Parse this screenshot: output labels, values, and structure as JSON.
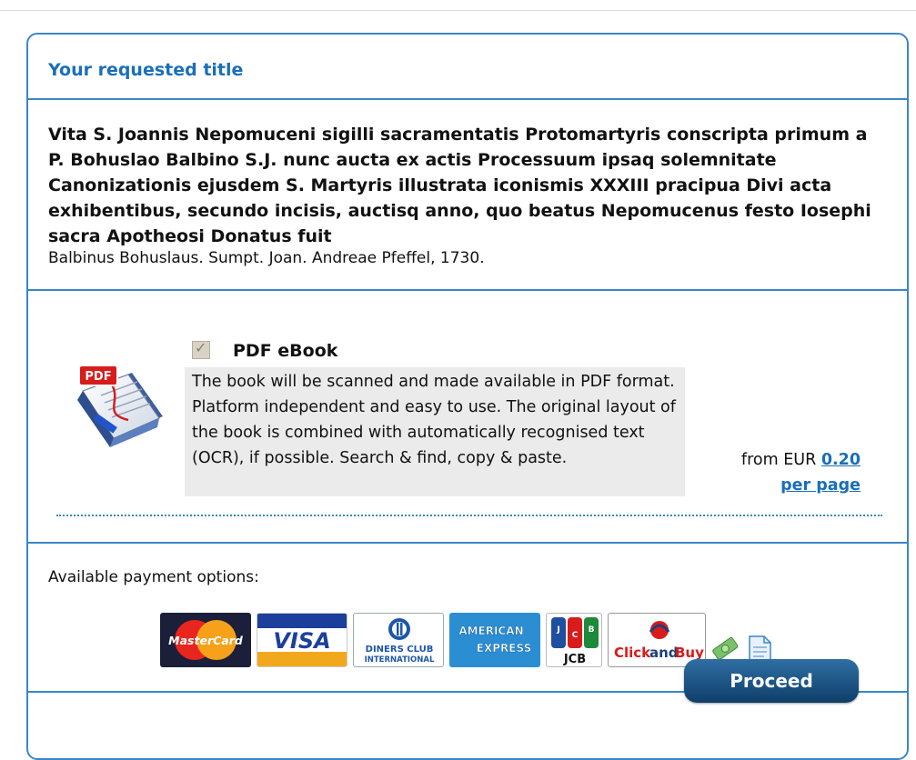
{
  "header": {
    "title": "Your requested title"
  },
  "book": {
    "title": "Vita S. Joannis Nepomuceni sigilli sacramentatis Protomartyris conscripta primum a P. Bohuslao Balbino S.J. nunc aucta ex actis Processuum ipsaq solemnitate Canonizationis ejusdem S. Martyris illustrata iconismis XXXIII pracipua Divi acta exhibentibus, secundo incisis, auctisq anno, quo beatus Nepomucenus festo Iosephi sacra Apotheosi Donatus fuit",
    "meta": "Balbinus Bohuslaus.  Sumpt. Joan. Andreae Pfeffel,  1730."
  },
  "option": {
    "icon_label": "PDF",
    "title": "PDF eBook",
    "description": "The book will be scanned and made available in PDF format. Platform independent and easy to use. The original layout of the book is combined with automatically recognised text (OCR), if possible. Search & find, copy & paste.",
    "price_prefix": "from EUR ",
    "price_link": "0.20",
    "price_suffix": "per page",
    "checked": true
  },
  "payment": {
    "label": "Available payment options:",
    "logos": {
      "mastercard": "MasterCard",
      "visa": "VISA",
      "diners_line1": "DINERS CLUB",
      "diners_line2": "INTERNATIONAL",
      "amex_line1": "AMERICAN",
      "amex_line2": "EXPRESS",
      "jcb": "JCB",
      "clickandbuy_click": "Click",
      "clickandbuy_and": "and",
      "clickandbuy_buy": "Buy"
    }
  },
  "actions": {
    "proceed": "Proceed"
  },
  "colors": {
    "accent": "#3a87c7",
    "link": "#1a6fb8",
    "button": "#1a4f7d"
  }
}
